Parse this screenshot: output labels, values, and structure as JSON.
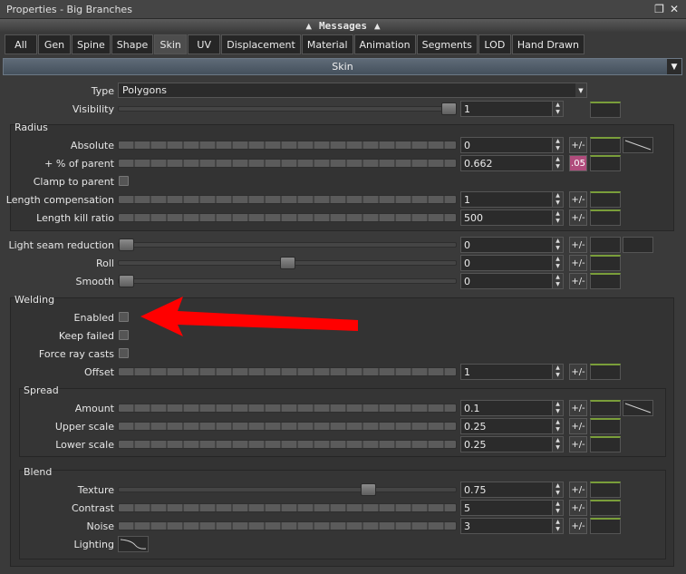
{
  "window": {
    "title": "Properties - Big Branches",
    "icons": [
      "restore-icon",
      "close-icon"
    ]
  },
  "messages": {
    "label": "Messages"
  },
  "tabs": [
    "All",
    "Gen",
    "Spine",
    "Shape",
    "Skin",
    "UV",
    "Displacement",
    "Material",
    "Animation",
    "Segments",
    "LOD",
    "Hand Drawn"
  ],
  "active_tab": "Skin",
  "section": {
    "title": "Skin"
  },
  "type": {
    "label": "Type",
    "value": "Polygons"
  },
  "visibility": {
    "label": "Visibility",
    "value": "1"
  },
  "radius": {
    "title": "Radius",
    "absolute": {
      "label": "Absolute",
      "value": "0"
    },
    "pct_parent": {
      "label": "+ % of parent",
      "value": "0.662",
      "badge": ".05"
    },
    "clamp": {
      "label": "Clamp to parent"
    },
    "length_comp": {
      "label": "Length compensation",
      "value": "1"
    },
    "length_kill": {
      "label": "Length kill ratio",
      "value": "500"
    }
  },
  "light_seam": {
    "label": "Light seam reduction",
    "value": "0"
  },
  "roll": {
    "label": "Roll",
    "value": "0"
  },
  "smooth": {
    "label": "Smooth",
    "value": "0"
  },
  "welding": {
    "title": "Welding",
    "enabled": {
      "label": "Enabled"
    },
    "keep_failed": {
      "label": "Keep failed"
    },
    "force_ray": {
      "label": "Force ray casts"
    },
    "offset": {
      "label": "Offset",
      "value": "1"
    }
  },
  "spread": {
    "title": "Spread",
    "amount": {
      "label": "Amount",
      "value": "0.1"
    },
    "upper": {
      "label": "Upper scale",
      "value": "0.25"
    },
    "lower": {
      "label": "Lower scale",
      "value": "0.25"
    }
  },
  "blend": {
    "title": "Blend",
    "texture": {
      "label": "Texture",
      "value": "0.75"
    },
    "contrast": {
      "label": "Contrast",
      "value": "5"
    },
    "noise": {
      "label": "Noise",
      "value": "3"
    },
    "lighting": {
      "label": "Lighting"
    }
  },
  "pm_label": "+/-"
}
